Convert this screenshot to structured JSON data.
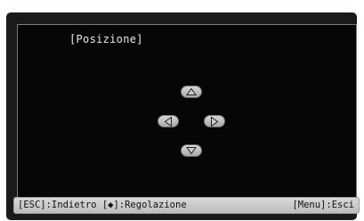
{
  "screen": {
    "title": "[Posizione]"
  },
  "status_bar": {
    "left_text": "[ESC]:Indietro [◆]:Regolazione",
    "right_text": "[Menu]:Esci"
  },
  "icons": {
    "up": "arrow-up-icon",
    "down": "arrow-down-icon",
    "left": "arrow-left-icon",
    "right": "arrow-right-icon"
  },
  "colors": {
    "background": "#060606",
    "text": "#e8e8e8",
    "button": "#c4c4c4",
    "status_bar": "#cccccc"
  }
}
